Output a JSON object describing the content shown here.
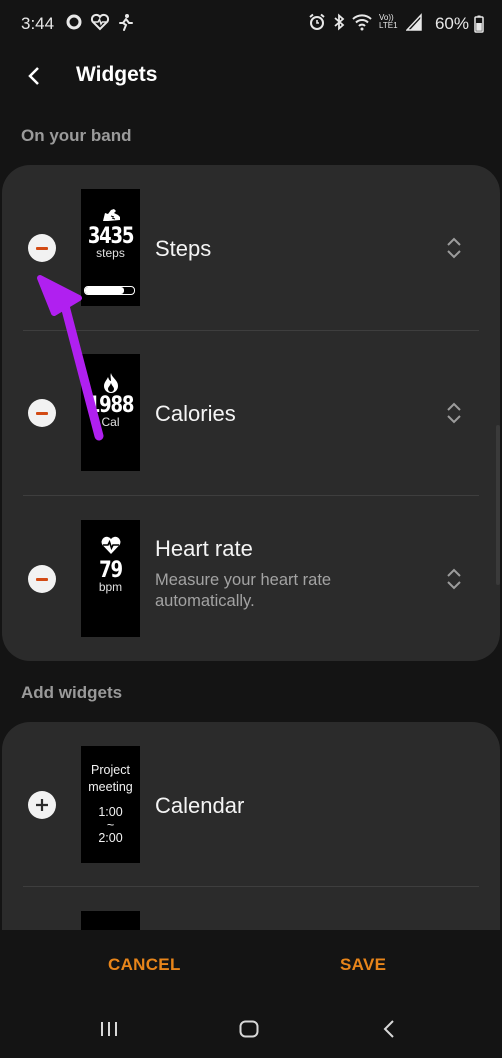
{
  "status_bar": {
    "time": "3:44",
    "battery": "60%",
    "left_icons": [
      "circle-o-icon",
      "heart-pulse-icon",
      "run-icon"
    ],
    "right_icons": [
      "alarm-icon",
      "bluetooth-icon",
      "wifi-icon",
      "volte-lte-icon",
      "signal-icon"
    ],
    "volte_label": "Vo)) LTE1"
  },
  "app_bar": {
    "title": "Widgets",
    "back_icon": "back-arrow-icon"
  },
  "on_your_band": {
    "header": "On your band",
    "items": [
      {
        "title": "Steps",
        "subtitle": "",
        "thumb_value": "3435",
        "thumb_unit": "steps",
        "thumb_icon": "shoe-icon",
        "thumb_progress": 0.8
      },
      {
        "title": "Calories",
        "subtitle": "",
        "thumb_value": "1988",
        "thumb_unit": "Cal",
        "thumb_icon": "flame-icon"
      },
      {
        "title": "Heart rate",
        "subtitle_line1": "Measure your heart rate",
        "subtitle_line2": "automatically.",
        "thumb_value": "79",
        "thumb_unit": "bpm",
        "thumb_icon": "heart-rate-icon"
      }
    ]
  },
  "add_widgets": {
    "header": "Add widgets",
    "items": [
      {
        "title": "Calendar",
        "thumb_line1": "Project",
        "thumb_line2": "meeting",
        "thumb_line3": "1:00",
        "thumb_line4": "~",
        "thumb_line5": "2:00"
      }
    ]
  },
  "actions": {
    "cancel": "CANCEL",
    "save": "SAVE"
  },
  "nav": {
    "recents_icon": "recents-icon",
    "home_icon": "home-icon",
    "back_icon": "nav-back-icon"
  },
  "colors": {
    "background": "#141414",
    "card": "#2b2b2b",
    "accent": "#e8851a",
    "minus": "#d24a14",
    "annotation": "#b020f0"
  }
}
